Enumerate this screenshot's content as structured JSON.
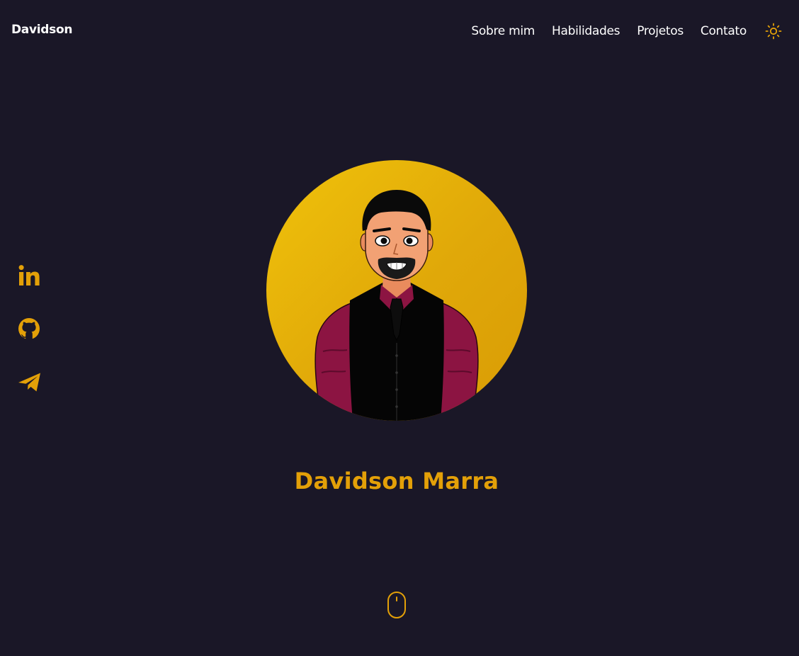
{
  "header": {
    "logo": "Davidson",
    "nav": [
      "Sobre mim",
      "Habilidades",
      "Projetos",
      "Contato"
    ],
    "theme_icon": "sun-icon"
  },
  "social": [
    {
      "name": "linkedin",
      "icon": "linkedin-icon"
    },
    {
      "name": "github",
      "icon": "github-icon"
    },
    {
      "name": "telegram",
      "icon": "telegram-icon"
    }
  ],
  "hero": {
    "name": "Davidson Marra",
    "avatar": "avatar-illustration",
    "scroll_icon": "mouse-icon"
  },
  "colors": {
    "background": "#1a1727",
    "accent": "#e3a008",
    "text": "#ffffff",
    "shirt": "#8c1442",
    "vest": "#050505"
  }
}
